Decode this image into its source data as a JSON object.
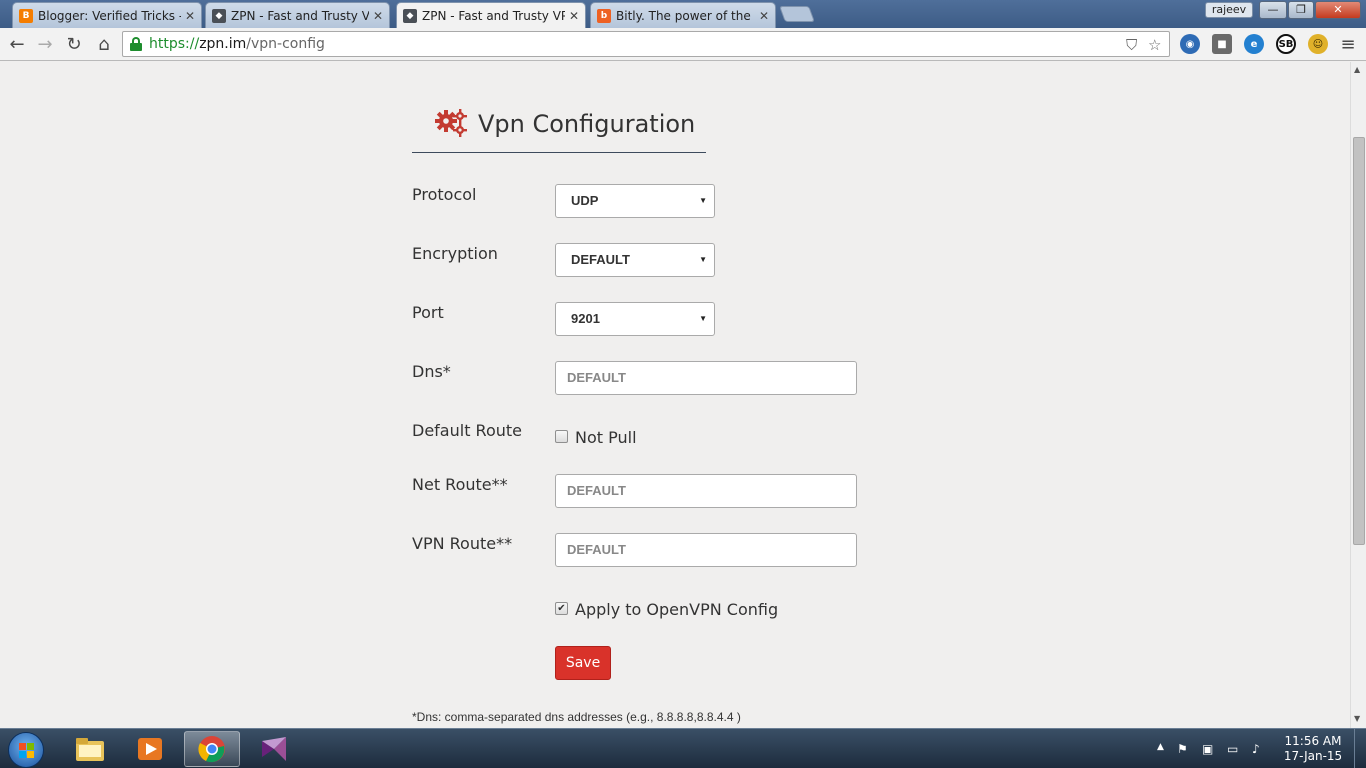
{
  "browser": {
    "tabs": [
      {
        "title": "Blogger: Verified Tricks - C",
        "favicon": "blogger-icon",
        "color": "#f57d00"
      },
      {
        "title": "ZPN - Fast and Trusty VPN",
        "favicon": "zpn-shield-icon",
        "color": "#4a4f56"
      },
      {
        "title": "ZPN - Fast and Trusty VPN",
        "favicon": "zpn-shield-icon",
        "color": "#4a4f56"
      },
      {
        "title": "Bitly. The power of the link",
        "favicon": "bitly-icon",
        "color": "#ee6123"
      }
    ],
    "user": "rajeev",
    "url": {
      "scheme": "https://",
      "host": "zpn.im",
      "path": "/vpn-config"
    },
    "window_buttons": {
      "minimize": "—",
      "maximize": "❐",
      "close": "✕"
    }
  },
  "page": {
    "title": "Vpn Configuration",
    "accent": "#c33b31",
    "fields": {
      "protocol": {
        "label": "Protocol",
        "value": "UDP"
      },
      "encryption": {
        "label": "Encryption",
        "value": "DEFAULT"
      },
      "port": {
        "label": "Port",
        "value": "9201"
      },
      "dns": {
        "label": "Dns*",
        "placeholder": "DEFAULT"
      },
      "default_route": {
        "label": "Default Route",
        "checkbox_label": "Not Pull",
        "checked": false
      },
      "net_route": {
        "label": "Net Route**",
        "placeholder": "DEFAULT"
      },
      "vpn_route": {
        "label": "VPN Route**",
        "placeholder": "DEFAULT"
      },
      "apply": {
        "checkbox_label": "Apply to OpenVPN Config",
        "checked": true
      }
    },
    "save_label": "Save",
    "footnote": "*Dns: comma-separated dns addresses (e.g., 8.8.8.8,8.8.4.4 )"
  },
  "taskbar": {
    "time": "11:56 AM",
    "date": "17-Jan-15",
    "apps": [
      "windows-explorer-icon",
      "media-player-icon",
      "chrome-icon",
      "visual-studio-icon"
    ]
  }
}
